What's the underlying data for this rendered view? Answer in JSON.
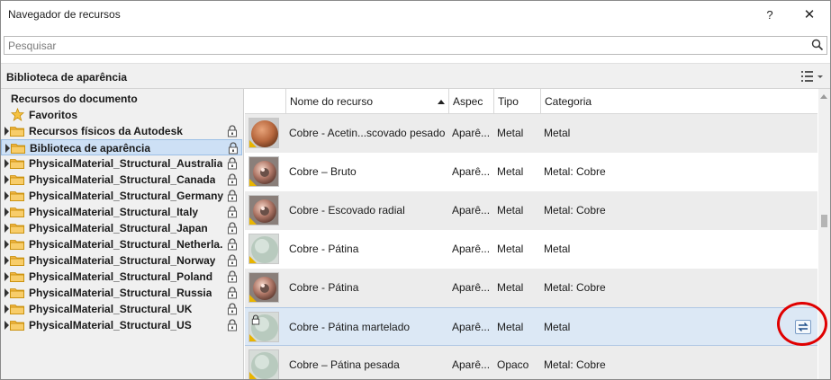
{
  "window": {
    "title": "Navegador de recursos",
    "help_label": "?",
    "close_label": "✕"
  },
  "search": {
    "placeholder": "Pesquisar",
    "value": ""
  },
  "library_header": {
    "title": "Biblioteca de aparência"
  },
  "tree": {
    "root_label": "Recursos do documento",
    "favorites_label": "Favoritos",
    "items": [
      {
        "label": "Recursos físicos da Autodesk",
        "locked": true,
        "selected": false
      },
      {
        "label": "Biblioteca de aparência",
        "locked": true,
        "selected": true
      },
      {
        "label": "PhysicalMaterial_Structural_Australia",
        "locked": true,
        "selected": false
      },
      {
        "label": "PhysicalMaterial_Structural_Canada",
        "locked": true,
        "selected": false
      },
      {
        "label": "PhysicalMaterial_Structural_Germany",
        "locked": true,
        "selected": false
      },
      {
        "label": "PhysicalMaterial_Structural_Italy",
        "locked": true,
        "selected": false
      },
      {
        "label": "PhysicalMaterial_Structural_Japan",
        "locked": true,
        "selected": false
      },
      {
        "label": "PhysicalMaterial_Structural_Netherla...",
        "locked": true,
        "selected": false
      },
      {
        "label": "PhysicalMaterial_Structural_Norway",
        "locked": true,
        "selected": false
      },
      {
        "label": "PhysicalMaterial_Structural_Poland",
        "locked": true,
        "selected": false
      },
      {
        "label": "PhysicalMaterial_Structural_Russia",
        "locked": true,
        "selected": false
      },
      {
        "label": "PhysicalMaterial_Structural_UK",
        "locked": true,
        "selected": false
      },
      {
        "label": "PhysicalMaterial_Structural_US",
        "locked": true,
        "selected": false
      }
    ]
  },
  "table": {
    "columns": [
      "Nome do recurso",
      "Aspec",
      "Tipo",
      "Categoria"
    ],
    "rows": [
      {
        "name": "Cobre - Acetin...scovado pesado",
        "aspect": "Aparê...",
        "type": "Metal",
        "category": "Metal",
        "thumb": "copper-flat"
      },
      {
        "name": "Cobre – Bruto",
        "aspect": "Aparê...",
        "type": "Metal",
        "category": "Metal: Cobre",
        "thumb": "copper-torus"
      },
      {
        "name": "Cobre - Escovado radial",
        "aspect": "Aparê...",
        "type": "Metal",
        "category": "Metal: Cobre",
        "thumb": "copper-torus"
      },
      {
        "name": "Cobre - Pátina",
        "aspect": "Aparê...",
        "type": "Metal",
        "category": "Metal",
        "thumb": "patina-sphere"
      },
      {
        "name": "Cobre - Pátina",
        "aspect": "Aparê...",
        "type": "Metal",
        "category": "Metal: Cobre",
        "thumb": "copper-torus"
      },
      {
        "name": "Cobre - Pátina martelado",
        "aspect": "Aparê...",
        "type": "Metal",
        "category": "Metal",
        "thumb": "patina-sphere-locked"
      },
      {
        "name": "Cobre – Pátina pesada",
        "aspect": "Aparê...",
        "type": "Opaco",
        "category": "Metal: Cobre",
        "thumb": "patina-sphere"
      }
    ]
  },
  "colors": {
    "selection": "#cde0f5",
    "highlight_circle": "#e00000",
    "folder": "#f2b544",
    "badge": "#e8b400"
  },
  "icons": {
    "search": "search-icon",
    "view": "list-view-icon",
    "star": "star-icon",
    "folder": "folder-icon",
    "lock": "lock-icon",
    "swap": "swap-asset-icon"
  }
}
